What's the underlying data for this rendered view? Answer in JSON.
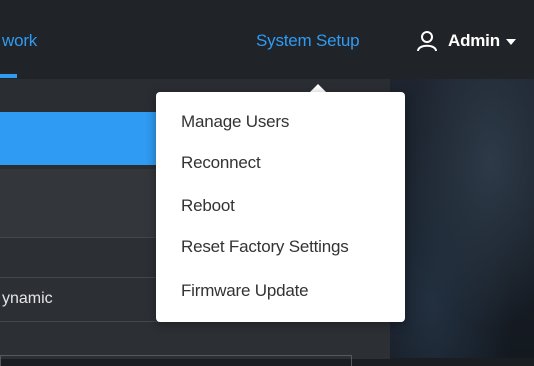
{
  "nav": {
    "network_label": "work",
    "system_setup_label": "System Setup",
    "user_label": "Admin",
    "user_icon": "user-icon",
    "caret_icon": "caret-down-icon"
  },
  "panel": {
    "row_value": "ynamic"
  },
  "dropdown": {
    "items": [
      {
        "label": "Manage Users"
      },
      {
        "label": "Reconnect"
      },
      {
        "label": "Reboot"
      },
      {
        "label": "Reset Factory Settings"
      },
      {
        "label": "Firmware Update"
      }
    ]
  },
  "colors": {
    "accent": "#2f9bf2",
    "topbar": "#202328",
    "menu_text": "#333333"
  }
}
